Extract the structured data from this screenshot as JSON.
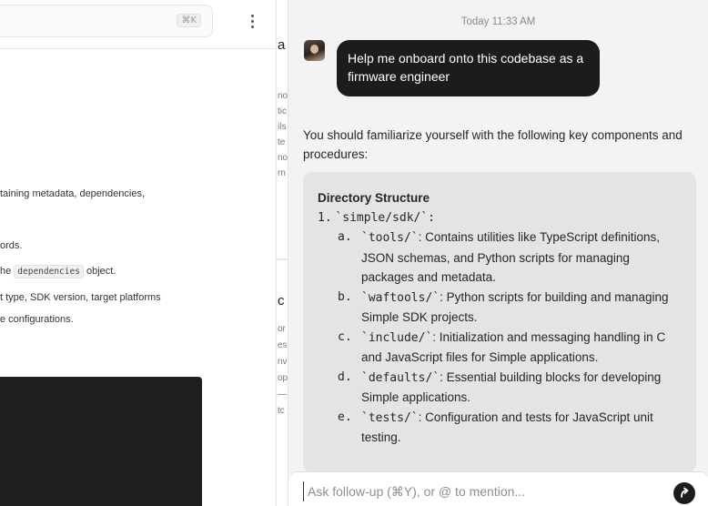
{
  "left_panel": {
    "search_shortcut": "⌘K",
    "lines": [
      {
        "text": "taining metadata, dependencies,"
      },
      {
        "text": "ords."
      },
      {
        "before": "he ",
        "code": "dependencies",
        "after": " object."
      },
      {
        "text": "t type, SDK version, target platforms"
      },
      {
        "text": "e configurations."
      }
    ]
  },
  "middle_fragments": {
    "top": [
      "a",
      "no",
      "tic",
      "ils",
      "te",
      "no",
      "rn"
    ],
    "bottom": [
      "c (",
      "or",
      "es",
      "nv",
      "op",
      "—",
      "tc"
    ]
  },
  "chat": {
    "timestamp": "Today 11:33 AM",
    "user_message": "Help me onboard onto this codebase as a firmware engineer",
    "intro": "You should familiarize yourself with the following key components and procedures:",
    "answer": {
      "heading": "Directory Structure",
      "item_number": "1.",
      "item_path": "`simple/sdk/`:",
      "subitems": [
        {
          "letter": "a.",
          "path": "`tools/`",
          "text": ": Contains utilities like TypeScript definitions, JSON schemas, and Python scripts for managing packages and metadata."
        },
        {
          "letter": "b.",
          "path": "`waftools/`",
          "text": ": Python scripts for building and managing Simple SDK projects."
        },
        {
          "letter": "c.",
          "path": "`include/`",
          "text": ": Initialization and messaging handling in C and JavaScript files for Simple applications."
        },
        {
          "letter": "d.",
          "path": "`defaults/`",
          "text": ": Essential building blocks for developing Simple applications."
        },
        {
          "letter": "e.",
          "path": "`tests/`",
          "text": ": Configuration and tests for JavaScript unit testing."
        }
      ]
    },
    "followup": {
      "placeholder": "Ask follow-up (⌘Y), or @ to mention..."
    }
  }
}
